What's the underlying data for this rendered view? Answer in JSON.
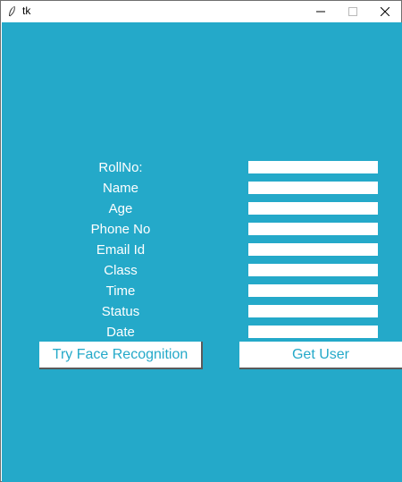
{
  "window": {
    "title": "tk",
    "controls": {
      "minimize": "minimize",
      "maximize": "maximize",
      "close": "close"
    }
  },
  "form": {
    "labels": [
      "RollNo:",
      "Name",
      "Age",
      "Phone No",
      "Email Id",
      "Class",
      "Time",
      "Status",
      "Date"
    ],
    "values": [
      "",
      "",
      "",
      "",
      "",
      "",
      "",
      "",
      ""
    ]
  },
  "buttons": {
    "face_recognition": "Try Face Recognition",
    "get_user": "Get User"
  },
  "colors": {
    "background": "#24a9c9",
    "button_text": "#24a9c9",
    "field_bg": "#ffffff"
  },
  "icons": {
    "app": "feather-icon"
  }
}
